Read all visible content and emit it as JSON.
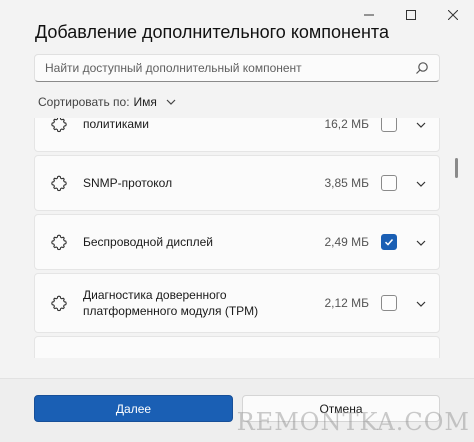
{
  "dialog": {
    "title": "Добавление дополнительного компонента",
    "search": {
      "placeholder": "Найти доступный дополнительный компонент",
      "value": ""
    },
    "sort": {
      "label": "Сортировать по:",
      "value": "Имя"
    }
  },
  "features": [
    {
      "name": "политиками",
      "size": "16,2 МБ",
      "checked": false,
      "icon": "gear-icon"
    },
    {
      "name": "SNMP-протокол",
      "size": "3,85 МБ",
      "checked": false,
      "icon": "gear-icon"
    },
    {
      "name": "Беспроводной дисплей",
      "size": "2,49 МБ",
      "checked": true,
      "icon": "gear-icon"
    },
    {
      "name": "Диагностика доверенного платформенного модуля (TPM)",
      "size": "2,12 МБ",
      "checked": false,
      "icon": "gear-icon"
    }
  ],
  "footer": {
    "next_label": "Далее",
    "cancel_label": "Отмена"
  },
  "watermark": "REMONTKA.COM",
  "colors": {
    "accent": "#1a5fb4",
    "background": "#f3f3f3"
  }
}
